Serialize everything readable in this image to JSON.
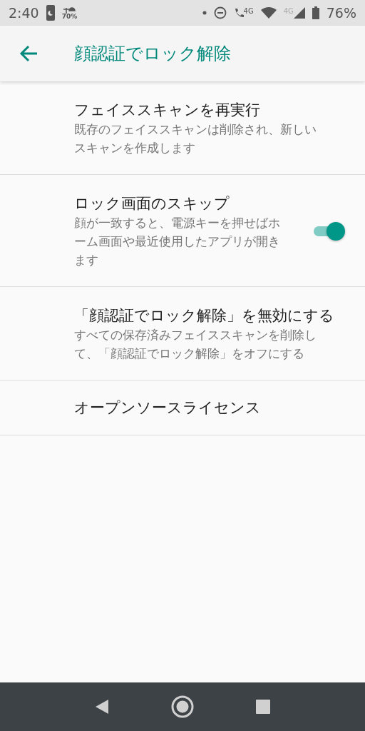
{
  "status_bar": {
    "time": "2:40",
    "weather": "70%",
    "call_network": "4G",
    "mobile_network": "4G",
    "battery": "76%"
  },
  "app_bar": {
    "title": "顔認証でロック解除"
  },
  "settings": [
    {
      "kind": "plain",
      "title": "フェイススキャンを再実行",
      "summary": "既存のフェイススキャンは削除され、新しいスキャンを作成します"
    },
    {
      "kind": "switch",
      "title": "ロック画面のスキップ",
      "summary": "顔が一致すると、電源キーを押せばホーム画面や最近使用したアプリが開きます",
      "on": true
    },
    {
      "kind": "plain",
      "title": "「顔認証でロック解除」を無効にする",
      "summary": "すべての保存済みフェイススキャンを削除して、「顔認証でロック解除」をオフにする"
    },
    {
      "kind": "plain",
      "title": "オープンソースライセンス"
    }
  ]
}
